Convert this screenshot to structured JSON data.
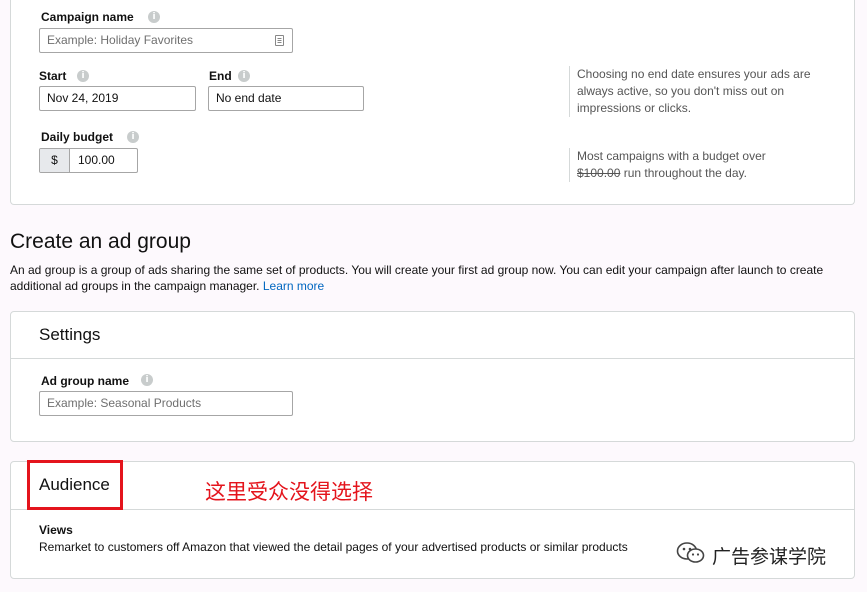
{
  "campaign": {
    "name_label": "Campaign name",
    "name_placeholder": "Example: Holiday Favorites",
    "start_label": "Start",
    "start_value": "Nov 24, 2019",
    "end_label": "End",
    "end_value": "No end date",
    "end_help": "Choosing no end date ensures your ads are always active, so you don't miss out on impressions or clicks.",
    "budget_label": "Daily budget",
    "currency": "$",
    "budget_value": "100.00",
    "budget_help_prefix": "Most campaigns with a budget over",
    "budget_help_amount": "$100.00",
    "budget_help_suffix": "run throughout the day."
  },
  "ad_group": {
    "title": "Create an ad group",
    "description": "An ad group is a group of ads sharing the same set of products. You will create your first ad group now. You can edit your campaign after launch to create additional ad groups in the campaign manager.",
    "learn_more": "Learn more"
  },
  "settings": {
    "title": "Settings",
    "name_label": "Ad group name",
    "name_placeholder": "Example: Seasonal Products"
  },
  "audience": {
    "title": "Audience",
    "annotation": "这里受众没得选择",
    "views_label": "Views",
    "views_desc": "Remarket to customers off Amazon that viewed the detail pages of your advertised products or similar products"
  },
  "watermark": {
    "text": "广告参谋学院",
    "icon": "wechat-icon"
  },
  "colors": {
    "annotation": "#e4141c",
    "link": "#0066c0",
    "border": "#d5d9d9"
  }
}
